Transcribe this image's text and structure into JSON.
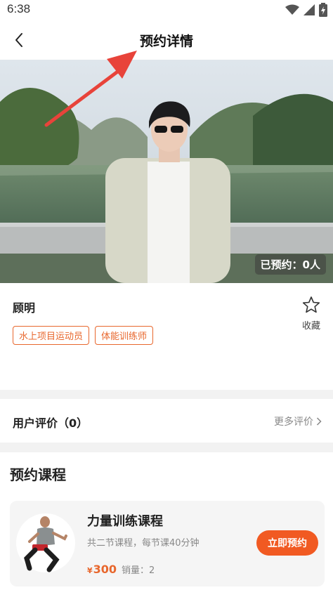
{
  "status_bar": {
    "time": "6:38"
  },
  "nav": {
    "title": "预约详情"
  },
  "hero": {
    "booked": "已预约：0人"
  },
  "profile": {
    "name": "顾明",
    "tags": [
      "水上项目运动员",
      "体能训练师"
    ],
    "favorite_label": "收藏"
  },
  "reviews": {
    "title": "用户评价（0）",
    "more": "更多评价"
  },
  "courses": {
    "title": "预约课程",
    "items": [
      {
        "name": "力量训练课程",
        "desc": "共二节课程，每节课40分钟",
        "currency": "¥",
        "price": "300",
        "sales": "销量：2",
        "button": "立即预约"
      }
    ]
  },
  "colors": {
    "accent": "#f15a22",
    "tag": "#e8672d",
    "arrow": "#e8433a"
  },
  "icons": [
    "wifi-icon",
    "signal-icon",
    "battery-icon",
    "back-arrow-icon",
    "star-icon",
    "chevron-right-icon"
  ]
}
